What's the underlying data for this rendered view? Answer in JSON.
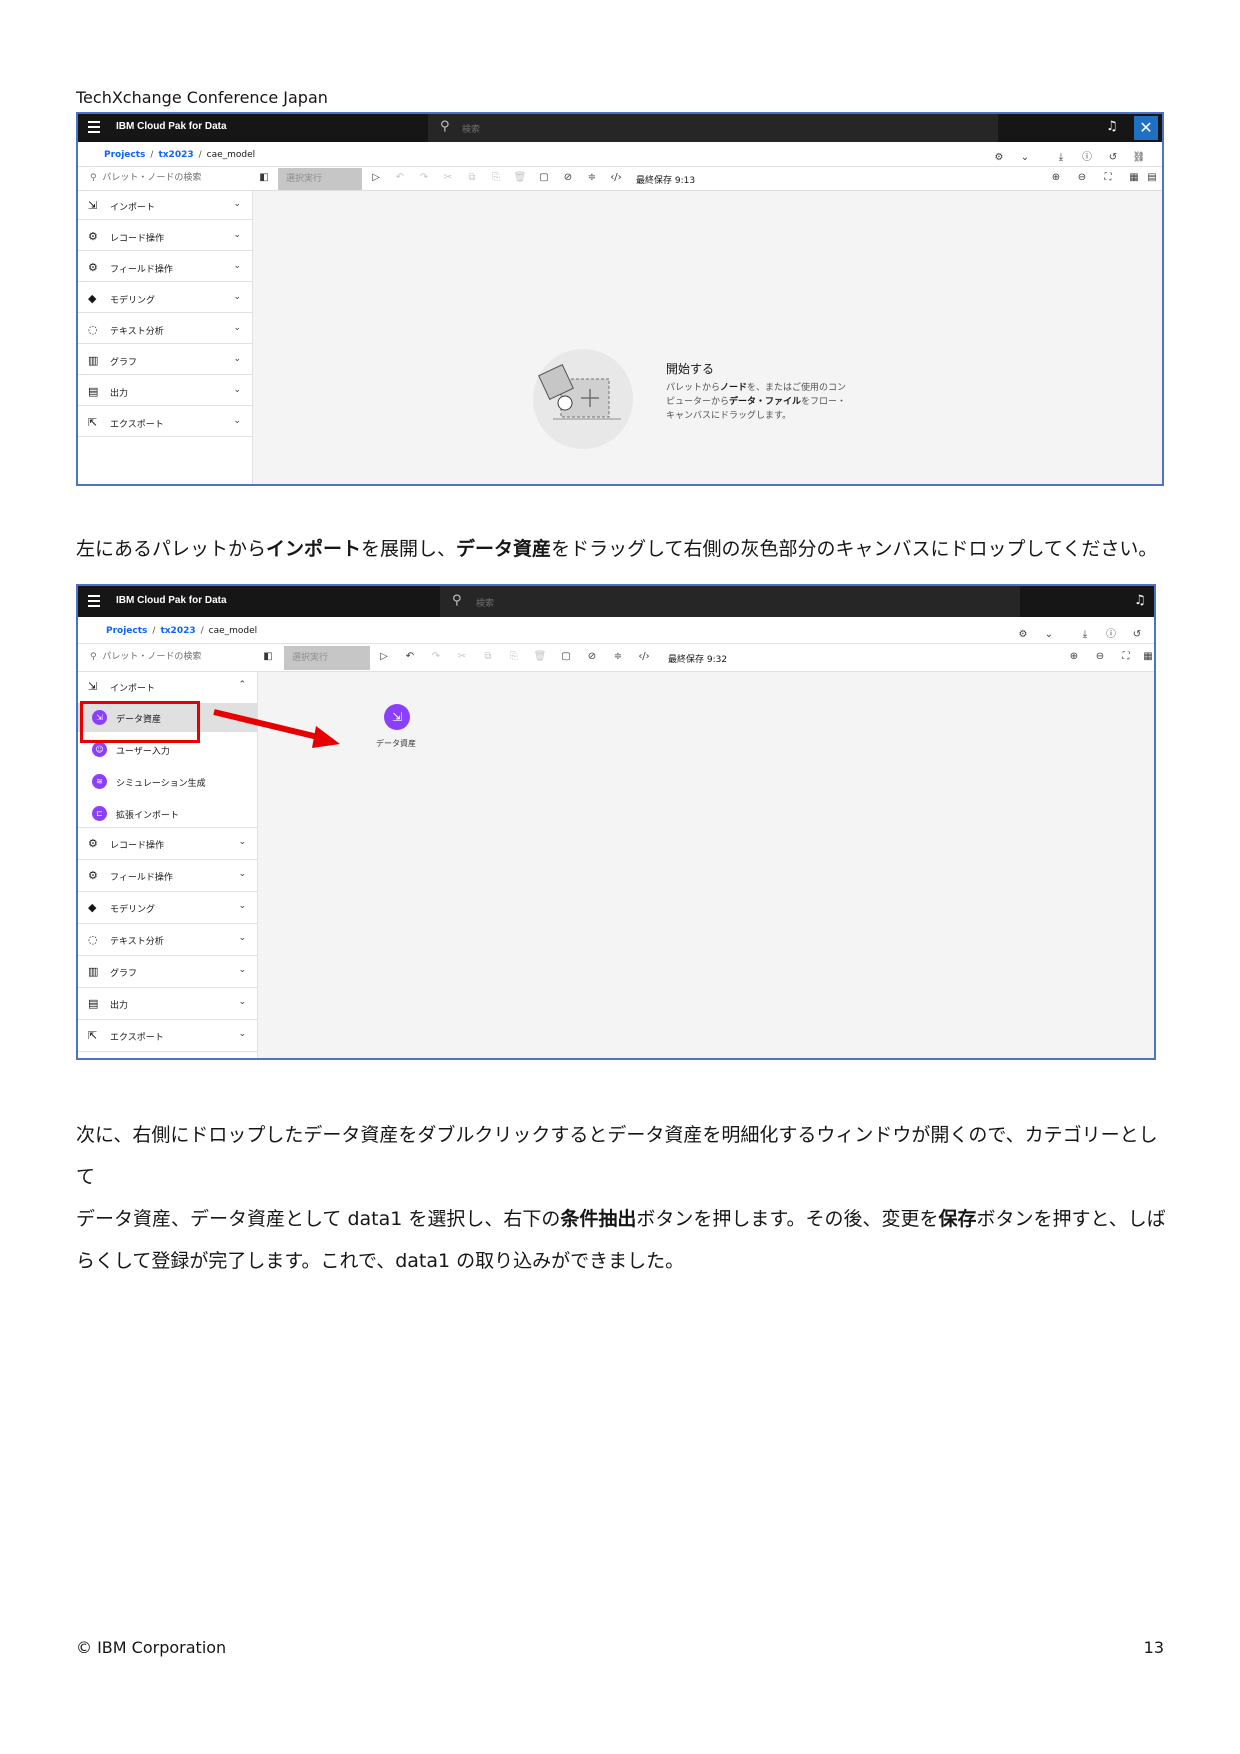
{
  "page": {
    "header": "TechXchange Conference Japan",
    "footer_left": "© IBM Corporation",
    "page_number": "13"
  },
  "screenshot1": {
    "brand": "IBM Cloud Pak for Data",
    "search_placeholder": "検索",
    "breadcrumb": {
      "project": "Projects",
      "folder": "tx2023",
      "current": "cae_model"
    },
    "palette_search": "パレット・ノードの検索",
    "run_selection": "選択実行",
    "last_saved": "最終保存 9:13",
    "palette": [
      "インポート",
      "レコード操作",
      "フィールド操作",
      "モデリング",
      "テキスト分析",
      "グラフ",
      "出力",
      "エクスポート"
    ],
    "empty_state": {
      "title": "開始する",
      "line1_a": "パレットから",
      "line1_b": "ノード",
      "line1_c": "を、またはご使用のコン",
      "line2_a": "ピューターから",
      "line2_b": "データ・ファイル",
      "line2_c": "をフロー・",
      "line3": "キャンバスにドラッグします。"
    }
  },
  "paragraph1": {
    "a": "左にあるパレットから",
    "b": "インポート",
    "c": "を展開し、",
    "d": "データ資産",
    "e": "をドラッグして右側の灰色部分のキャンバスにドロップしてください。"
  },
  "screenshot2": {
    "brand": "IBM Cloud Pak for Data",
    "search_placeholder": "検索",
    "breadcrumb": {
      "project": "Projects",
      "folder": "tx2023",
      "current": "cae_model"
    },
    "palette_search": "パレット・ノードの検索",
    "run_selection": "選択実行",
    "last_saved": "最終保存 9:32",
    "import_label": "インポート",
    "import_items": [
      "データ資産",
      "ユーザー入力",
      "シミュレーション生成",
      "拡張インポート"
    ],
    "palette_rest": [
      "レコード操作",
      "フィールド操作",
      "モデリング",
      "テキスト分析",
      "グラフ",
      "出力",
      "エクスポート"
    ],
    "canvas_node_label": "データ資産"
  },
  "paragraph2": {
    "line1": "次に、右側にドロップしたデータ資産をダブルクリックするとデータ資産を明細化するウィンドウが開くので、カテゴリーとして",
    "line2_a": "データ資産、データ資産として data1 を選択し、右下の",
    "line2_b": "条件抽出",
    "line2_c": "ボタンを押します。その後、変更を",
    "line2_d": "保存",
    "line2_e": "ボタンを押すと、しば",
    "line3": "らくして登録が完了します。これで、data1 の取り込みができました。"
  },
  "colors": {
    "frame": "#4f72c4",
    "accent": "#8a3ffc",
    "link": "#0f62fe",
    "highlight": "#e60000"
  },
  "icons": [
    "menu-icon",
    "search-icon",
    "bell-icon",
    "avatar-icon",
    "chevron-down-icon",
    "chevron-up-icon",
    "play-icon",
    "undo-icon",
    "redo-icon",
    "zoom-in-icon",
    "zoom-out-icon",
    "download-icon",
    "info-icon",
    "history-icon"
  ]
}
